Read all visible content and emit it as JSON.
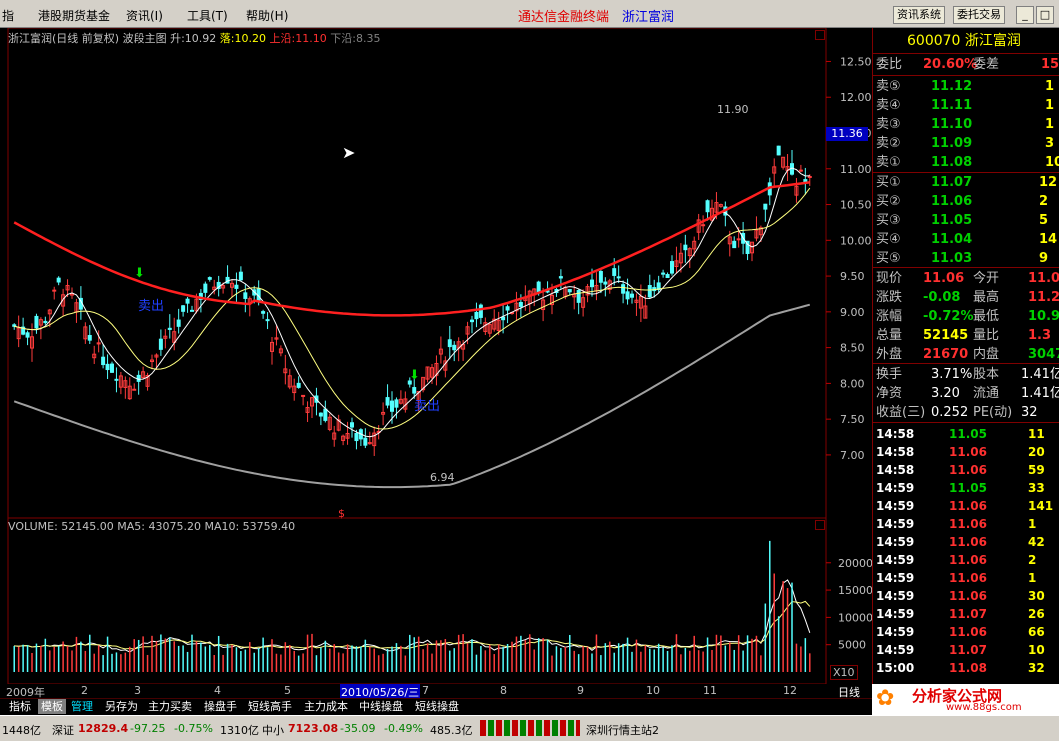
{
  "menu": {
    "items": [
      "指",
      "港股期货基金",
      "资讯(I)",
      "工具(T)",
      "帮助(H)"
    ],
    "app_title": "通达信金融终端",
    "stock_title": "浙江富润",
    "btn_info": "资讯系统",
    "btn_trade": "委托交易"
  },
  "price_panel": {
    "name": "浙江富润(日线 前复权) 波段主图",
    "sheng_label": "升:",
    "sheng_value": "10.92",
    "luo_label": "落:",
    "luo_value": "10.20",
    "shangyan_label": "上沿:",
    "shangyan_value": "11.10",
    "xiayan_label": "下沿:",
    "xiayan_value": "8.35",
    "high_label": "11.90",
    "low_label": "6.94",
    "sell_text": "卖出",
    "sell_text2": "卖出",
    "current_price_tag": "11.36",
    "marker": "$"
  },
  "volume_panel": {
    "title": "VOLUME: 52145.00  MA5: 43075.20  MA10: 53759.40",
    "unit": "X10"
  },
  "chart_data": {
    "type": "candlestick",
    "y_axis_price": [
      12.5,
      12.0,
      11.5,
      11.0,
      10.5,
      10.0,
      9.5,
      9.0,
      8.5,
      8.0,
      7.5,
      7.0
    ],
    "y_axis_volume": [
      20000,
      15000,
      10000,
      5000
    ],
    "x_labels": [
      "2009年",
      "2",
      "3",
      "4",
      "5",
      "2010/05/26/三",
      "7",
      "8",
      "9",
      "10",
      "11",
      "12"
    ],
    "period_label": "日线",
    "close_approx": [
      8.8,
      8.7,
      8.9,
      9.4,
      9.1,
      8.6,
      8.3,
      8.1,
      8.0,
      8.3,
      8.6,
      8.9,
      9.2,
      9.4,
      9.5,
      9.3,
      9.1,
      8.6,
      8.1,
      7.8,
      7.6,
      7.4,
      7.3,
      7.2,
      7.5,
      7.7,
      7.9,
      8.1,
      8.4,
      8.6,
      8.8,
      8.9,
      9.0,
      9.1,
      9.2,
      9.3,
      9.4,
      9.2,
      9.3,
      9.5,
      9.3,
      9.1,
      9.4,
      9.6,
      9.8,
      10.3,
      10.5,
      10.0,
      9.8,
      10.4,
      11.2,
      10.8,
      11.0
    ]
  },
  "quote": {
    "code_name": "600070 浙江富润",
    "weibi_label": "委比",
    "weibi_value": "20.60%",
    "weicha_label": "委差",
    "weicha_value": "15",
    "sells": [
      {
        "label": "卖⑤",
        "price": "11.12",
        "vol": "1"
      },
      {
        "label": "卖④",
        "price": "11.11",
        "vol": "1"
      },
      {
        "label": "卖③",
        "price": "11.10",
        "vol": "1"
      },
      {
        "label": "卖②",
        "price": "11.09",
        "vol": "3"
      },
      {
        "label": "卖①",
        "price": "11.08",
        "vol": "10"
      }
    ],
    "buys": [
      {
        "label": "买①",
        "price": "11.07",
        "vol": "12"
      },
      {
        "label": "买②",
        "price": "11.06",
        "vol": "2"
      },
      {
        "label": "买③",
        "price": "11.05",
        "vol": "5"
      },
      {
        "label": "买④",
        "price": "11.04",
        "vol": "14"
      },
      {
        "label": "买⑤",
        "price": "11.03",
        "vol": "9"
      }
    ],
    "stats": [
      {
        "l1": "现价",
        "v1": "11.06",
        "l2": "今开",
        "v2": "11.0",
        "c1": "#ff3030",
        "c2": "#ff3030"
      },
      {
        "l1": "涨跌",
        "v1": "-0.08",
        "l2": "最高",
        "v2": "11.2",
        "c1": "#00d000",
        "c2": "#ff3030"
      },
      {
        "l1": "涨幅",
        "v1": "-0.72%",
        "l2": "最低",
        "v2": "10.9",
        "c1": "#00d000",
        "c2": "#00d000"
      },
      {
        "l1": "总量",
        "v1": "52145",
        "l2": "量比",
        "v2": "1.3",
        "c1": "#ffff00",
        "c2": "#ff3030"
      },
      {
        "l1": "外盘",
        "v1": "21670",
        "l2": "内盘",
        "v2": "3047",
        "c1": "#ff3030",
        "c2": "#00d000"
      }
    ],
    "fin": [
      {
        "l1": "换手",
        "v1": "3.71%",
        "l2": "股本",
        "v2": "1.41亿"
      },
      {
        "l1": "净资",
        "v1": "3.20",
        "l2": "流通",
        "v2": "1.41亿"
      },
      {
        "l1": "收益(三)",
        "v1": "0.252",
        "l2": "PE(动)",
        "v2": "32"
      }
    ],
    "ticks": [
      {
        "t": "14:58",
        "p": "11.05",
        "v": "11",
        "c": "#00d000"
      },
      {
        "t": "14:58",
        "p": "11.06",
        "v": "20",
        "c": "#ff3030"
      },
      {
        "t": "14:58",
        "p": "11.06",
        "v": "59",
        "c": "#ff3030"
      },
      {
        "t": "14:59",
        "p": "11.05",
        "v": "33",
        "c": "#00d000"
      },
      {
        "t": "14:59",
        "p": "11.06",
        "v": "141",
        "c": "#ff3030"
      },
      {
        "t": "14:59",
        "p": "11.06",
        "v": "1",
        "c": "#ff3030"
      },
      {
        "t": "14:59",
        "p": "11.06",
        "v": "42",
        "c": "#ff3030"
      },
      {
        "t": "14:59",
        "p": "11.06",
        "v": "2",
        "c": "#ff3030"
      },
      {
        "t": "14:59",
        "p": "11.06",
        "v": "1",
        "c": "#ff3030"
      },
      {
        "t": "14:59",
        "p": "11.06",
        "v": "30",
        "c": "#ff3030"
      },
      {
        "t": "14:59",
        "p": "11.07",
        "v": "26",
        "c": "#ff3030"
      },
      {
        "t": "14:59",
        "p": "11.06",
        "v": "66",
        "c": "#ff3030"
      },
      {
        "t": "14:59",
        "p": "11.07",
        "v": "10",
        "c": "#ff3030"
      },
      {
        "t": "15:00",
        "p": "11.08",
        "v": "32",
        "c": "#ff3030"
      }
    ]
  },
  "bottom_tabs": [
    "指标",
    "模板",
    "管理",
    "另存为",
    "主力买卖",
    "操盘手",
    "短线高手",
    "主力成本",
    "中线操盘",
    "短线操盘"
  ],
  "status": {
    "s1": "1448亿",
    "s2_label": "深证",
    "s2_value": "12829.4",
    "s2_chg": "-97.25",
    "s2_pct": "-0.75%",
    "s2_amt": "1310亿",
    "s3_label": "中小",
    "s3_value": "7123.08",
    "s3_chg": "-35.09",
    "s3_pct": "-0.49%",
    "s3_amt": "485.3亿",
    "server": "深圳行情主站2"
  },
  "logo": {
    "text": "分析家公式网",
    "url": "www.88gs.com"
  }
}
